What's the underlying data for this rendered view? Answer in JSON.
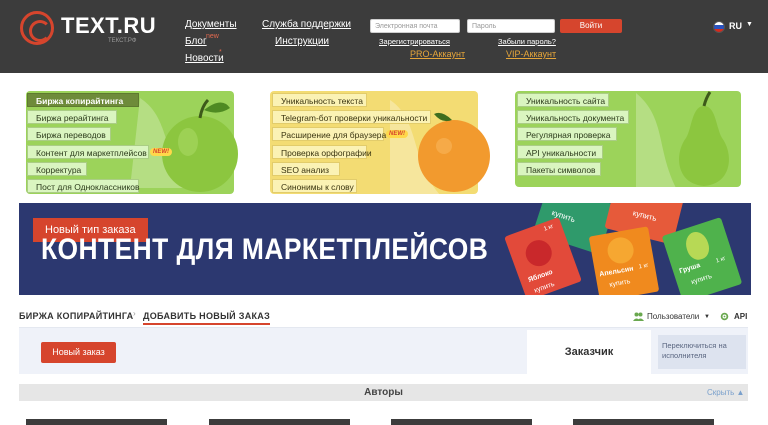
{
  "header": {
    "logo_text": "TEXT.RU",
    "logo_sub": "ТЕКСТ.РФ",
    "nav": {
      "documents": "Документы",
      "blog": "Блог",
      "blog_badge": "new",
      "news": "Новости",
      "news_badge": "*",
      "support": "Служба поддержки",
      "instructions": "Инструкции"
    },
    "login": {
      "email_placeholder": "Электронная почта",
      "password_placeholder": "Пароль",
      "button": "Войти",
      "register": "Зарегистрироваться",
      "forgot": "Забыли пароль?",
      "pro": "PRO-Аккаунт",
      "vip": "VIP-Аккаунт"
    },
    "lang": "RU",
    "lang_caret": "▼"
  },
  "promo": {
    "green_left": [
      {
        "label": "Биржа копирайтинга"
      },
      {
        "label": "Биржа рерайтинга"
      },
      {
        "label": "Биржа переводов"
      },
      {
        "label": "Контент для маркетплейсов",
        "badge": "NEW!"
      },
      {
        "label": "Корректура"
      },
      {
        "label": "Пост для Одноклассников"
      }
    ],
    "yellow_mid": [
      {
        "label": "Уникальность текста"
      },
      {
        "label": "Telegram-бот проверки уникальности"
      },
      {
        "label": "Расширение для браузера",
        "badge": "NEW!"
      },
      {
        "label": "Проверка орфографии"
      },
      {
        "label": "SEO анализ"
      },
      {
        "label": "Синонимы к слову"
      }
    ],
    "green_right": [
      {
        "label": "Уникальность сайта"
      },
      {
        "label": "Уникальность документа"
      },
      {
        "label": "Регулярная проверка"
      },
      {
        "label": "API уникальности"
      },
      {
        "label": "Пакеты символов"
      }
    ]
  },
  "banner": {
    "tag": "Новый тип заказа",
    "title": "КОНТЕНТ ДЛЯ МАРКЕТПЛЕЙСОВ",
    "cards": [
      {
        "label": "купить",
        "price": "1 кг",
        "product": "Яблоко"
      },
      {
        "label": "купить",
        "price": "1 кг",
        "product": "Апельсин"
      },
      {
        "label": "купить",
        "price": "1 кг",
        "product": "Груша"
      },
      {
        "label": "купить"
      },
      {
        "label": "купить"
      }
    ]
  },
  "breadcrumb": {
    "first": "Биржа копирайтинга",
    "separator": "›",
    "second": "Добавить новый заказ"
  },
  "toolbar": {
    "users": "Пользователи",
    "users_caret": "▼",
    "api": "API"
  },
  "order": {
    "new_order": "Новый заказ",
    "role_active": "Заказчик",
    "role_switch": "Переключиться на исполнителя"
  },
  "authors": {
    "title": "Авторы",
    "hide": "Скрыть ▲"
  },
  "colors": {
    "accent": "#d6452d",
    "header_bg": "#3c3c3c",
    "banner_bg": "#2c3870",
    "pro_link": "#e6a63a"
  }
}
